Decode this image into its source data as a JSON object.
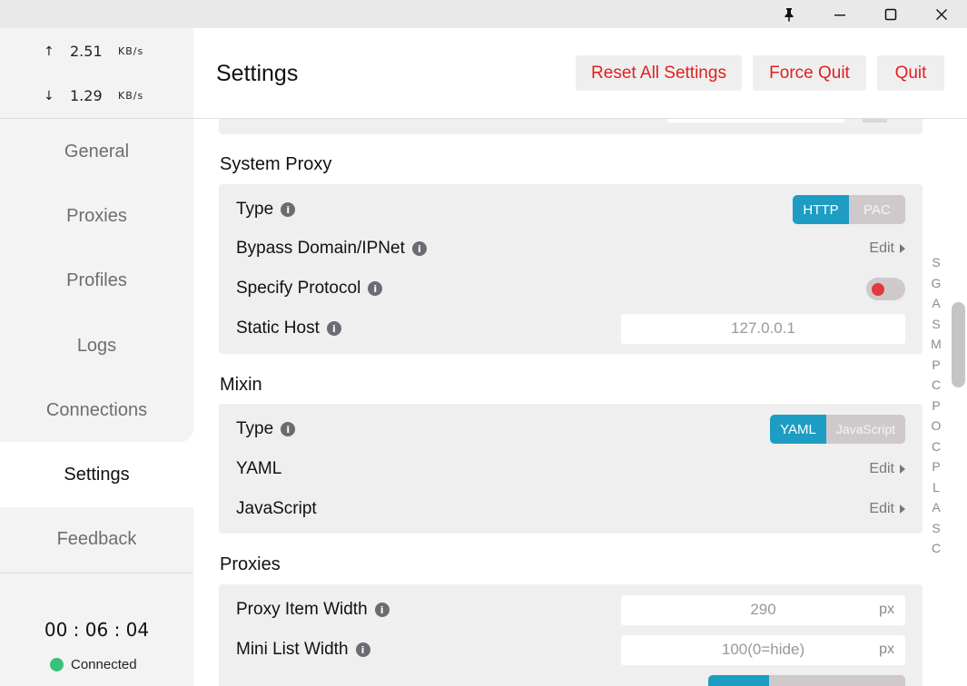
{
  "titlebar": {
    "icons": [
      "pin-icon",
      "minimize-icon",
      "maximize-icon",
      "close-icon"
    ]
  },
  "traffic": {
    "up": {
      "arrow": "↑",
      "value": "2.51",
      "unit": "KB/s"
    },
    "down": {
      "arrow": "↓",
      "value": "1.29",
      "unit": "KB/s"
    }
  },
  "nav": {
    "items": [
      "General",
      "Proxies",
      "Profiles",
      "Logs",
      "Connections",
      "Settings",
      "Feedback"
    ],
    "active": "Settings"
  },
  "status": {
    "timer": "00 : 06 : 04",
    "connection": "Connected",
    "color": "#3ac07b"
  },
  "header": {
    "title": "Settings",
    "reset_label": "Reset All Settings",
    "force_quit_label": "Force Quit",
    "quit_label": "Quit",
    "accent": "#e02020"
  },
  "system_proxy": {
    "title": "System Proxy",
    "type_label": "Type",
    "type_options": [
      "HTTP",
      "PAC"
    ],
    "type_selected": "HTTP",
    "bypass_label": "Bypass Domain/IPNet",
    "bypass_action": "Edit",
    "specify_label": "Specify Protocol",
    "specify_enabled": false,
    "static_host_label": "Static Host",
    "static_host_value": "127.0.0.1"
  },
  "mixin": {
    "title": "Mixin",
    "type_label": "Type",
    "type_options": [
      "YAML",
      "JavaScript"
    ],
    "type_selected": "YAML",
    "yaml_label": "YAML",
    "yaml_action": "Edit",
    "js_label": "JavaScript",
    "js_action": "Edit"
  },
  "proxies": {
    "title": "Proxies",
    "item_width_label": "Proxy Item Width",
    "item_width_value": "290",
    "item_width_unit": "px",
    "mini_width_label": "Mini List Width",
    "mini_width_value": "100(0=hide)",
    "mini_width_unit": "px"
  },
  "alpha_index": [
    "S",
    "G",
    "A",
    "S",
    "M",
    "P",
    "C",
    "P",
    "O",
    "C",
    "P",
    "L",
    "A",
    "S",
    "C"
  ],
  "colors": {
    "segment_on": "#1d9dc3",
    "segment_off": "#cfc9cb",
    "toggle_knob": "#e0393e"
  }
}
